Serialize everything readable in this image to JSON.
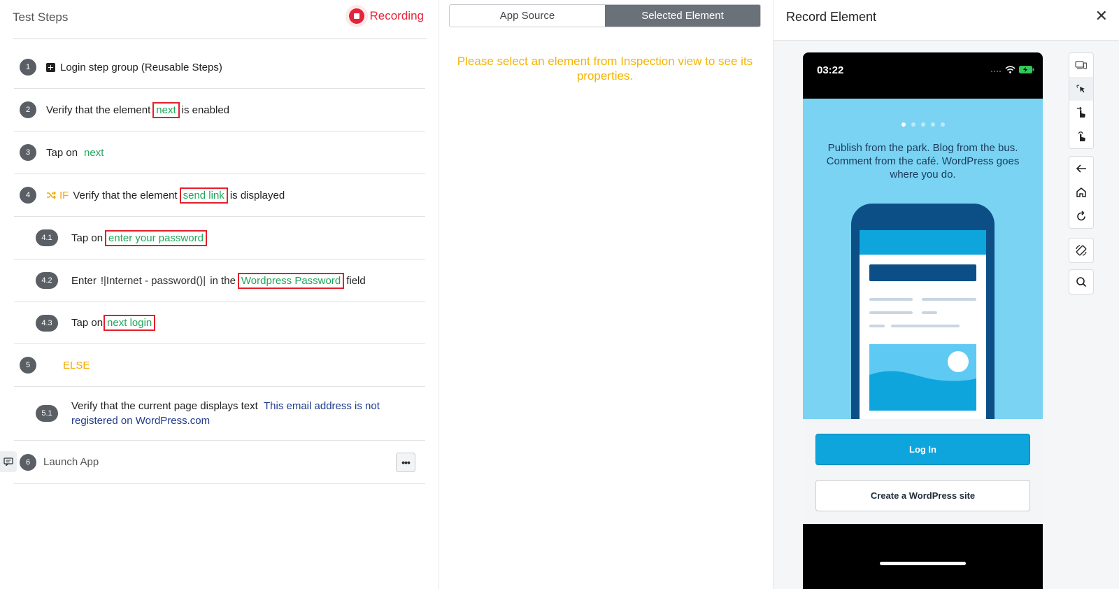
{
  "left": {
    "title": "Test Steps",
    "recording_label": "Recording"
  },
  "steps": [
    {
      "num": "1",
      "text": "Login step group (Reusable Steps)"
    },
    {
      "num": "2",
      "pre": "Verify that the element",
      "element": "next",
      "post": "is enabled"
    },
    {
      "num": "3",
      "pre": "Tap on",
      "element": "next"
    },
    {
      "num": "4",
      "if_label": "IF",
      "pre": "Verify that the element",
      "element": "send link",
      "post": "is displayed"
    },
    {
      "num": "4.1",
      "pre": "Tap on",
      "element": "enter your password"
    },
    {
      "num": "4.2",
      "pre": "Enter",
      "param": "!|Internet - password()|",
      "mid": "in the",
      "element": "Wordpress Password",
      "post": "field"
    },
    {
      "num": "4.3",
      "pre": "Tap on",
      "element": "next login"
    },
    {
      "num": "5",
      "else_label": "ELSE"
    },
    {
      "num": "5.1",
      "pre": "Verify that the current page displays text",
      "value_line1": "This email address is not",
      "value_line2": "registered on WordPress.com"
    },
    {
      "num": "6",
      "text": "Launch App",
      "more_label": "•••"
    }
  ],
  "middle": {
    "tabs": [
      "App Source",
      "Selected Element"
    ],
    "active_tab": "Selected Element",
    "hint_line1": "Please select an element from Inspection view to see its",
    "hint_line2": "properties."
  },
  "right": {
    "title": "Record Element",
    "close_label": "✕"
  },
  "device": {
    "time": "03:22",
    "tagline": "Publish from the park. Blog from the bus. Comment from the café. WordPress goes where you do.",
    "login_label": "Log In",
    "create_label": "Create a WordPress site",
    "active_dot": 0,
    "dots": 5
  },
  "colors": {
    "recording": "#e5233a",
    "element_green": "#1ea85a",
    "highlight_red": "#e4202b",
    "if_orange": "#f0a800",
    "hint_yellow": "#f5b400",
    "hero_blue": "#7ad3f2",
    "primary_button": "#0ea5dd"
  }
}
